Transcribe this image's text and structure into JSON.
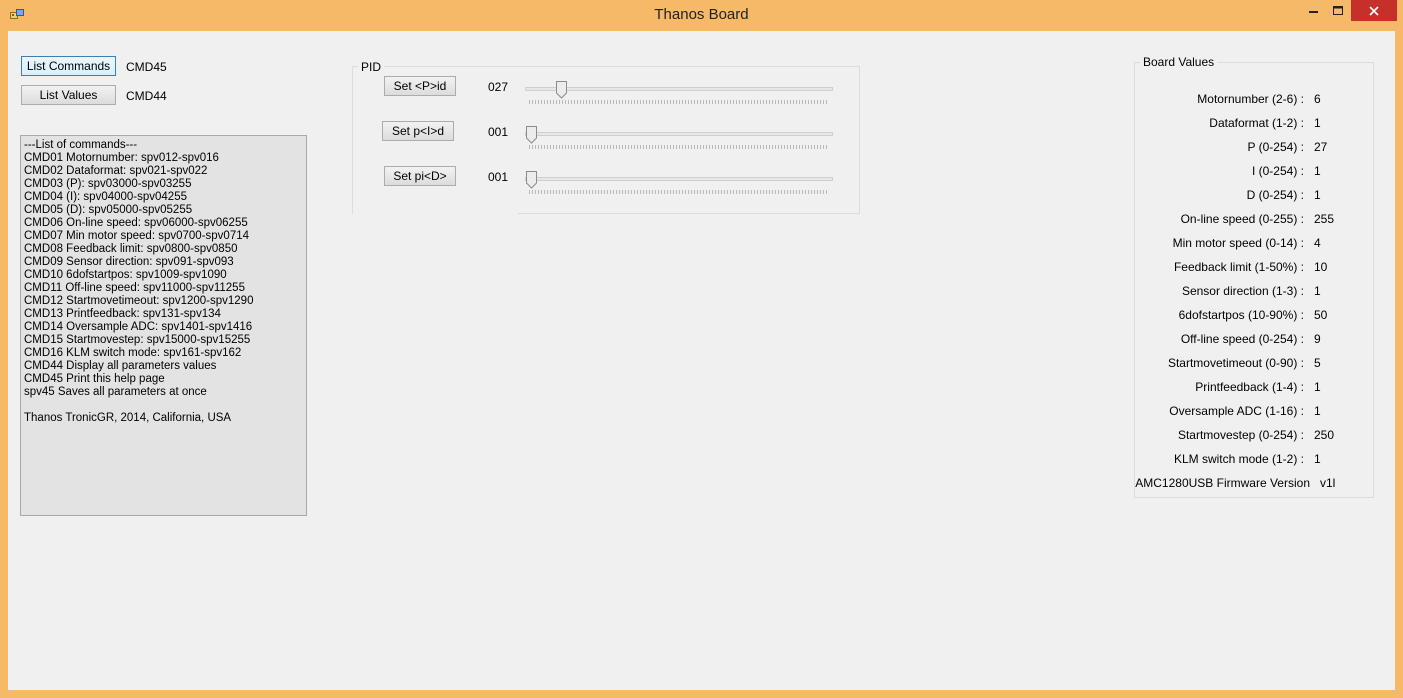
{
  "window": {
    "title": "Thanos Board"
  },
  "controls": {
    "list_commands_label": "List Commands",
    "list_commands_cmd": "CMD45",
    "list_values_label": "List Values",
    "list_values_cmd": "CMD44"
  },
  "commands_text": [
    "---List of commands---",
    "CMD01 Motornumber: spv012-spv016",
    "CMD02 Dataformat: spv021-spv022",
    "CMD03 (P): spv03000-spv03255",
    "CMD04 (I): spv04000-spv04255",
    "CMD05 (D): spv05000-spv05255",
    "CMD06 On-line speed: spv06000-spv06255",
    "CMD07 Min motor speed: spv0700-spv0714",
    "CMD08 Feedback limit: spv0800-spv0850",
    "CMD09 Sensor direction: spv091-spv093",
    "CMD10 6dofstartpos:  spv1009-spv1090",
    "CMD11 Off-line speed: spv11000-spv11255",
    "CMD12 Startmovetimeout: spv1200-spv1290",
    "CMD13 Printfeedback:  spv131-spv134",
    "CMD14 Oversample ADC: spv1401-spv1416",
    "CMD15 Startmovestep:   spv15000-spv15255",
    "CMD16 KLM switch mode:  spv161-spv162",
    "CMD44 Display all parameters values",
    "CMD45 Print this help page",
    "spv45 Saves all parameters at once",
    "",
    "Thanos TronicGR, 2014, California, USA"
  ],
  "pid": {
    "title": "PID",
    "rows": [
      {
        "button": "Set <P>id",
        "value": "027",
        "slider_value": 27,
        "slider_max": 255
      },
      {
        "button": "Set p<I>d",
        "value": "001",
        "slider_value": 1,
        "slider_max": 255
      },
      {
        "button": "Set pi<D>",
        "value": "001",
        "slider_value": 1,
        "slider_max": 255
      }
    ]
  },
  "board_values": {
    "title": "Board Values",
    "rows": [
      {
        "label": "Motornumber (2-6) :",
        "value": "6"
      },
      {
        "label": "Dataformat (1-2) :",
        "value": "1"
      },
      {
        "label": "P (0-254) :",
        "value": "27"
      },
      {
        "label": "I (0-254) :",
        "value": "1"
      },
      {
        "label": "D (0-254) :",
        "value": "1"
      },
      {
        "label": "On-line speed (0-255) :",
        "value": "255"
      },
      {
        "label": "Min motor speed (0-14) :",
        "value": "4"
      },
      {
        "label": "Feedback limit (1-50%) :",
        "value": "10"
      },
      {
        "label": "Sensor direction (1-3) :",
        "value": "1"
      },
      {
        "label": "6dofstartpos (10-90%) :",
        "value": "50"
      },
      {
        "label": "Off-line speed (0-254) :",
        "value": "9"
      },
      {
        "label": "Startmovetimeout (0-90) :",
        "value": "5"
      },
      {
        "label": "Printfeedback  (1-4) :",
        "value": "1"
      },
      {
        "label": "Oversample ADC (1-16) :",
        "value": "1"
      },
      {
        "label": "Startmovestep (0-254) :",
        "value": "250"
      },
      {
        "label": "KLM switch mode (1-2) :",
        "value": "1"
      },
      {
        "label": "AMC1280USB Firmware Version",
        "value": "v1l"
      }
    ]
  },
  "colors": {
    "frame": "#f6b967",
    "client": "#f0f0f0",
    "close": "#c7302a",
    "textbox": "#e3e3e3"
  }
}
